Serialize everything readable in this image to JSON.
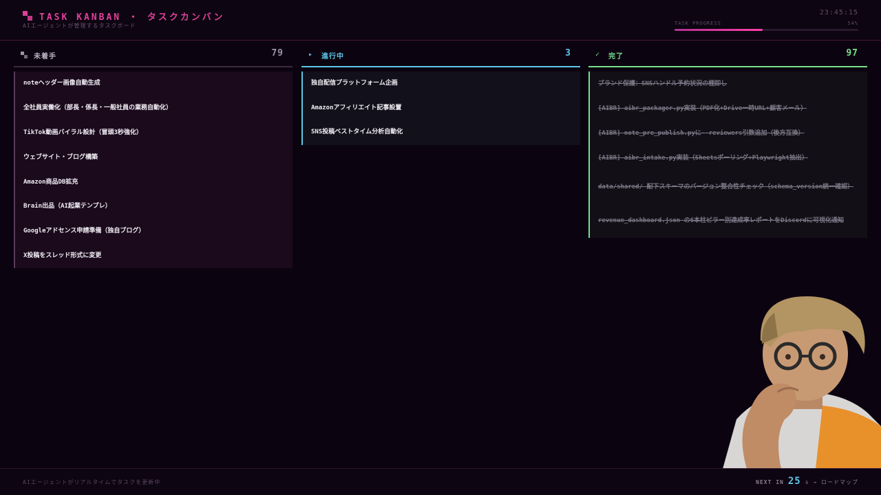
{
  "header": {
    "title": "TASK KANBAN ・ タスクカンバン",
    "subtitle": "AIエージェントが管理するタスクボード",
    "clock": "23:45:15",
    "progress_label": "TASK PROGRESS",
    "progress_pct_text": "54%",
    "progress_value": 0.48,
    "accent": "#e0409a"
  },
  "columns": {
    "todo": {
      "icon": "todo-squares-icon",
      "title": "未着手",
      "count": "79",
      "color": "#9d93a8",
      "cards": [
        "noteヘッダー画像自動生成",
        "全社員実働化（部長・係長・一般社員の業務自動化）",
        "TikTok動画バイラル設計（冒頭3秒強化）",
        "ウェブサイト・ブログ構築",
        "Amazon商品DB拡充",
        "Brain出品（AI起業テンプレ）",
        "Googleアドセンス申請準備（独自ブログ）",
        "X投稿をスレッド形式に変更"
      ]
    },
    "doing": {
      "icon": "▸",
      "title": "進行中",
      "count": "3",
      "color": "#5fc8e8",
      "cards": [
        "独自配信プラットフォーム企画",
        "Amazonアフィリエイト記事設置",
        "SNS投稿ベストタイム分析自動化"
      ]
    },
    "done": {
      "icon": "✓",
      "title": "完了",
      "count": "97",
      "color": "#79e08c",
      "cards": [
        "ブランド保護：SNSハンドル予約状況の棚卸し",
        "[AIBR] aibr_packager.py実装（PDF化+Drive一時URL+顧客メール）",
        "[AIBR] note_pre_publish.pyに--reviewers引数追加（後方互換）",
        "[AIBR] aibr_intake.py実装（Sheetsポーリング+Playwright抽出）",
        "data/shared/ 配下スキーマのバージョン整合性チェック（schema_version統一確認）",
        "revenue_dashboard.json の6本柱ピラー別達成率レポートをDiscordに可視化通知"
      ]
    }
  },
  "footer": {
    "status": "AIエージェントがリアルタイムでタスクを更新中",
    "next_label": "NEXT IN",
    "next_seconds": "25",
    "next_suffix": "s → ロードマップ"
  }
}
